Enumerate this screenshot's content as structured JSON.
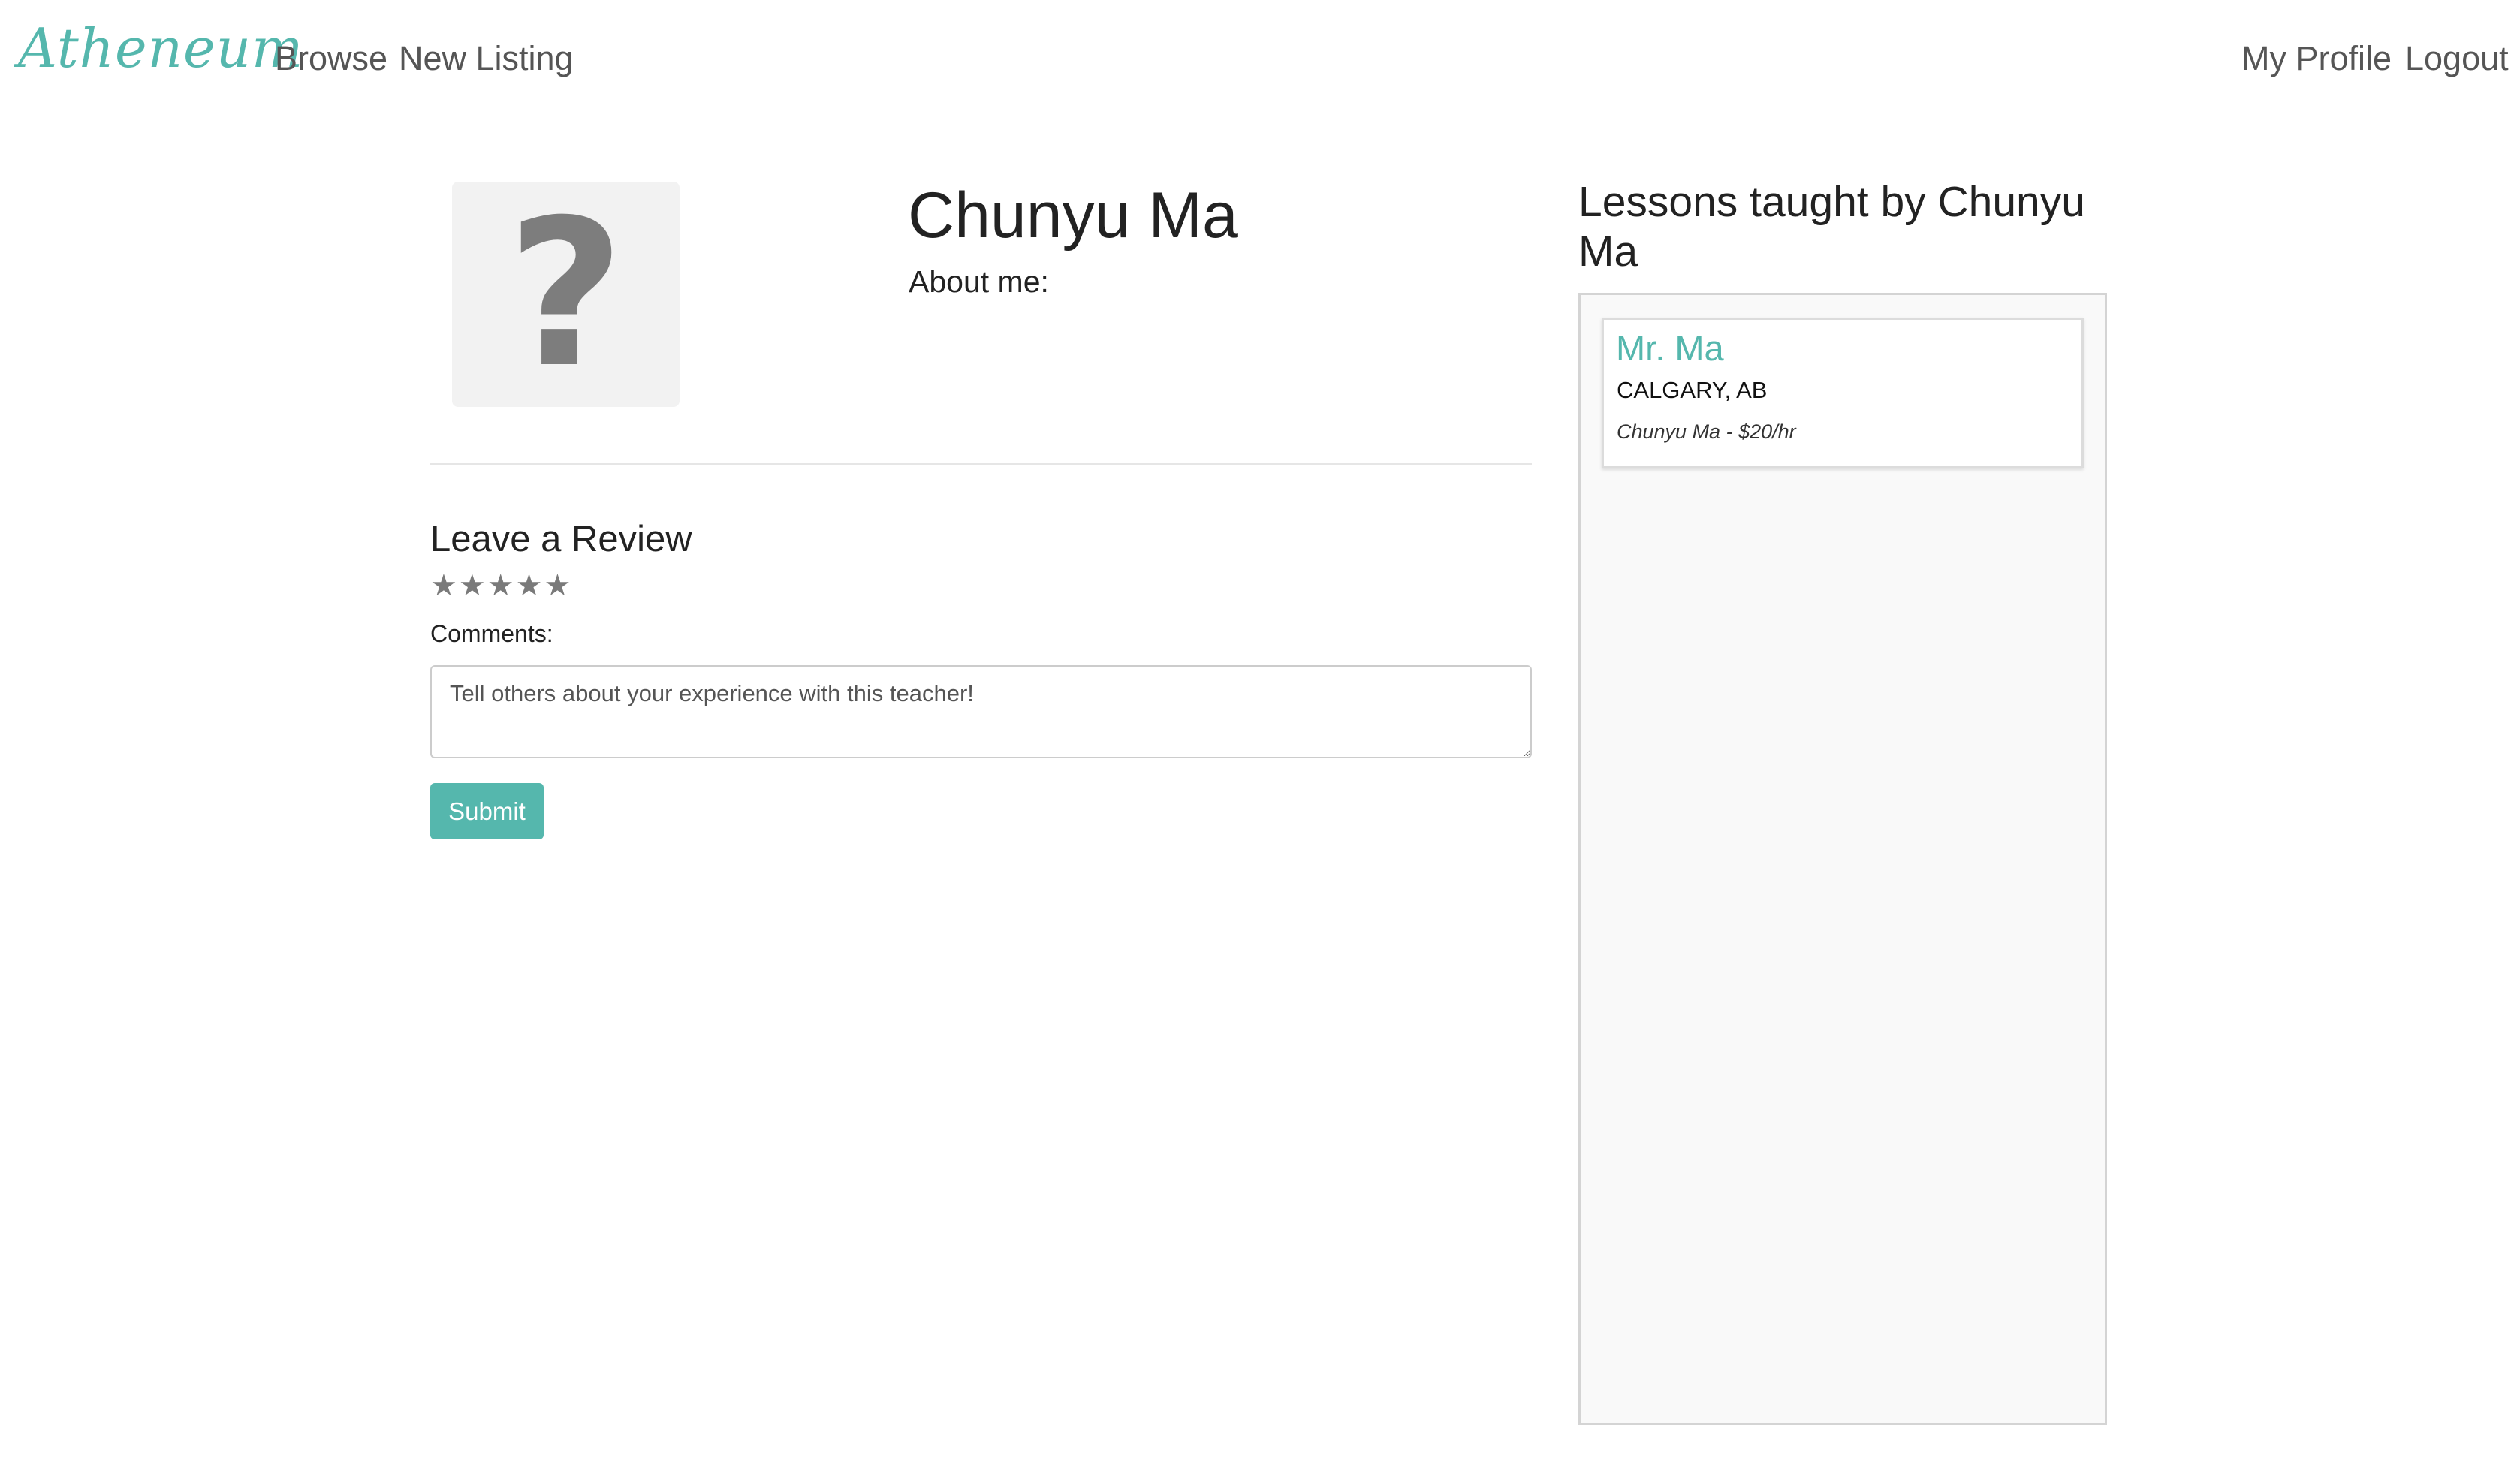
{
  "navbar": {
    "brand": "Atheneum",
    "links": {
      "browse": "Browse",
      "new_listing": "New Listing",
      "my_profile": "My Profile",
      "logout": "Logout"
    }
  },
  "profile": {
    "avatar_icon": "question-mark-icon",
    "avatar_glyph": "?",
    "name": "Chunyu Ma",
    "about_label": "About me:"
  },
  "review": {
    "heading": "Leave a Review",
    "stars": [
      "★",
      "★",
      "★",
      "★",
      "★"
    ],
    "rating_selected": 0,
    "rating_max": 5,
    "comments_label": "Comments:",
    "comments_placeholder": "Tell others about your experience with this teacher!",
    "comments_value": "",
    "submit_label": "Submit"
  },
  "lessons": {
    "heading": "Lessons taught by Chunyu Ma",
    "items": [
      {
        "title": "Mr. Ma",
        "location": "CALGARY, AB",
        "meta": "Chunyu Ma - $20/hr"
      }
    ]
  },
  "colors": {
    "accent": "#55b7ad",
    "text": "#222222",
    "muted": "#555555",
    "star": "#7a7a7a",
    "panel_bg": "#f9f9f9"
  }
}
